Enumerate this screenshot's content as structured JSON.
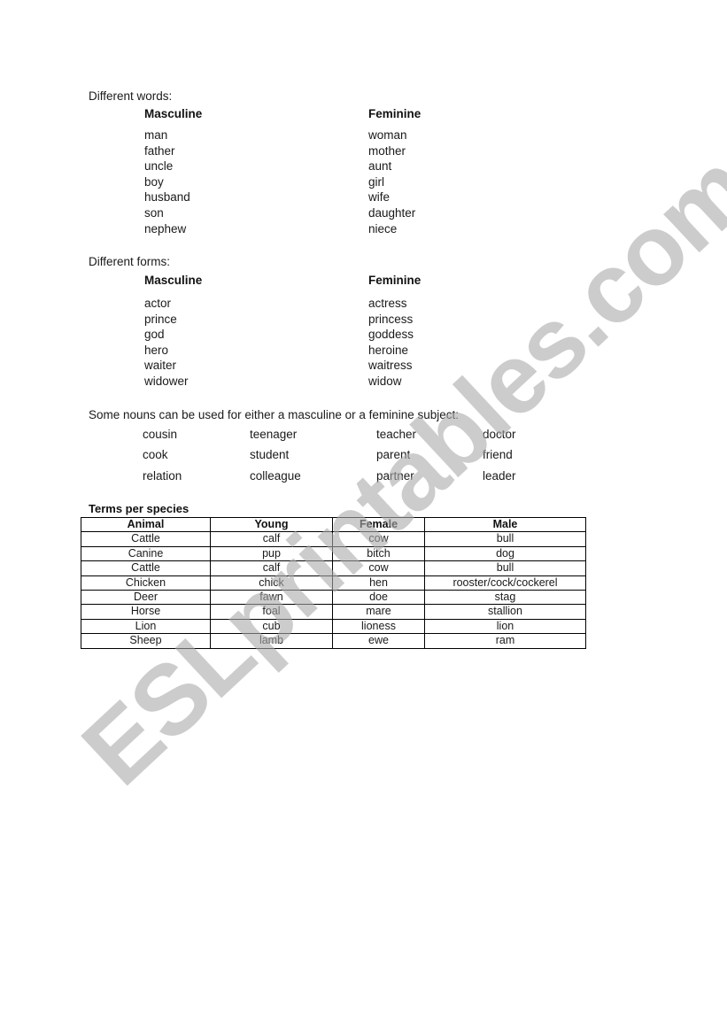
{
  "watermark": "ESLprintables.com",
  "different_words": {
    "label": "Different words:",
    "masculine_header": "Masculine",
    "feminine_header": "Feminine",
    "masculine": [
      "man",
      "father",
      "uncle",
      "boy",
      "husband",
      "son",
      "nephew"
    ],
    "feminine": [
      "woman",
      "mother",
      "aunt",
      "girl",
      "wife",
      "daughter",
      "niece"
    ]
  },
  "different_forms": {
    "label": "Different forms:",
    "masculine_header": "Masculine",
    "feminine_header": "Feminine",
    "masculine": [
      "actor",
      "prince",
      "god",
      "hero",
      "waiter",
      "widower"
    ],
    "feminine": [
      "actress",
      "princess",
      "goddess",
      "heroine",
      "waitress",
      "widow"
    ]
  },
  "either": {
    "label": "Some nouns can be used for either a masculine or a feminine subject:",
    "rows": [
      [
        "cousin",
        "teenager",
        "teacher",
        "doctor"
      ],
      [
        "cook",
        "student",
        "parent",
        "friend"
      ],
      [
        "relation",
        "colleague",
        "partner",
        "leader"
      ]
    ]
  },
  "species": {
    "caption": "Terms per species",
    "headers": [
      "Animal",
      "Young",
      "Female",
      "Male"
    ],
    "rows": [
      [
        "Cattle",
        "calf",
        "cow",
        "bull"
      ],
      [
        "Canine",
        "pup",
        "bitch",
        "dog"
      ],
      [
        "Cattle",
        "calf",
        "cow",
        "bull"
      ],
      [
        "Chicken",
        "chick",
        "hen",
        "rooster/cock/cockerel"
      ],
      [
        "Deer",
        "fawn",
        "doe",
        "stag"
      ],
      [
        "Horse",
        "foal",
        "mare",
        "stallion"
      ],
      [
        "Lion",
        "cub",
        "lioness",
        "lion"
      ],
      [
        "Sheep",
        "lamb",
        "ewe",
        "ram"
      ]
    ]
  }
}
